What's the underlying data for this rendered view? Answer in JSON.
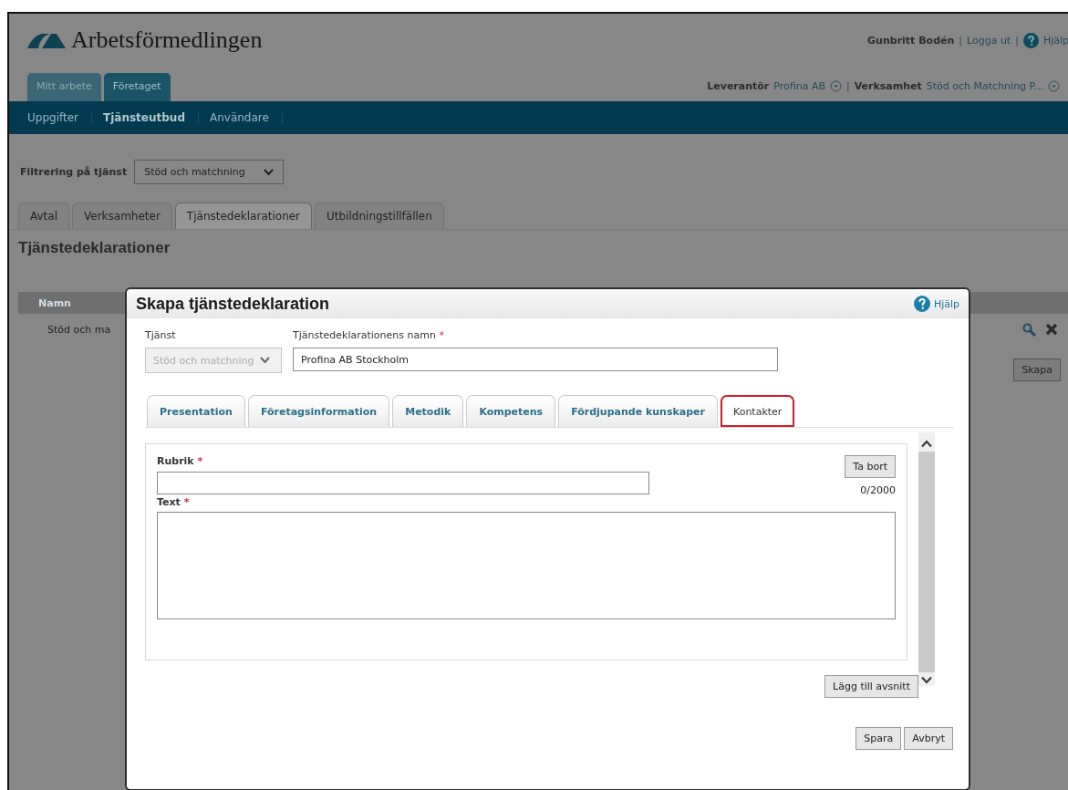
{
  "header": {
    "logo_text": "Arbetsförmedlingen",
    "user": "Gunbritt Bodén",
    "separator_1": "|",
    "logout": "Logga ut",
    "separator_2": "|",
    "help": "Hjälp"
  },
  "top_tabs": [
    {
      "label": "Mitt arbete",
      "selected": false
    },
    {
      "label": "Företaget",
      "selected": true
    }
  ],
  "context": {
    "supplier_label": "Leverantör",
    "supplier_value": "Profina AB",
    "separator": "|",
    "business_label": "Verksamhet",
    "business_value": "Stöd och Matchning P..."
  },
  "nav": [
    {
      "label": "Uppgifter",
      "selected": false
    },
    {
      "label": "Tjänsteutbud",
      "selected": true
    },
    {
      "label": "Användare",
      "selected": false
    }
  ],
  "filter": {
    "label": "Filtrering på tjänst",
    "value": "Stöd och matchning"
  },
  "page_tabs": [
    {
      "label": "Avtal",
      "selected": false
    },
    {
      "label": "Verksamheter",
      "selected": false
    },
    {
      "label": "Tjänstedeklarationer",
      "selected": true
    },
    {
      "label": "Utbildningstillfällen",
      "selected": false
    }
  ],
  "page_heading": "Tjänstedeklarationer",
  "table": {
    "columns": [
      "Namn"
    ],
    "rows": [
      [
        "Stöd och ma"
      ]
    ]
  },
  "create_button": "Skapa",
  "dialog": {
    "title": "Skapa tjänstedeklaration",
    "help": "Hjälp",
    "service": {
      "label": "Tjänst",
      "value": "Stöd och matchning",
      "disabled": true
    },
    "name": {
      "label": "Tjänstedeklarationens namn",
      "required_mark": "*",
      "value": "Profina AB Stockholm"
    },
    "tabs": [
      {
        "label": "Presentation",
        "selected": false,
        "highlighted": false
      },
      {
        "label": "Företagsinformation",
        "selected": false,
        "highlighted": false
      },
      {
        "label": "Metodik",
        "selected": false,
        "highlighted": false
      },
      {
        "label": "Kompetens",
        "selected": false,
        "highlighted": false
      },
      {
        "label": "Fördjupande kunskaper",
        "selected": false,
        "highlighted": false
      },
      {
        "label": "Kontakter",
        "selected": true,
        "highlighted": true
      }
    ],
    "section": {
      "heading_label": "Rubrik",
      "heading_required_mark": "*",
      "remove_button": "Ta bort",
      "counter": "0/2000",
      "text_label": "Text",
      "text_required_mark": "*"
    },
    "add_section_button": "Lägg till avsnitt",
    "buttons": [
      "Spara",
      "Avbryt"
    ]
  }
}
